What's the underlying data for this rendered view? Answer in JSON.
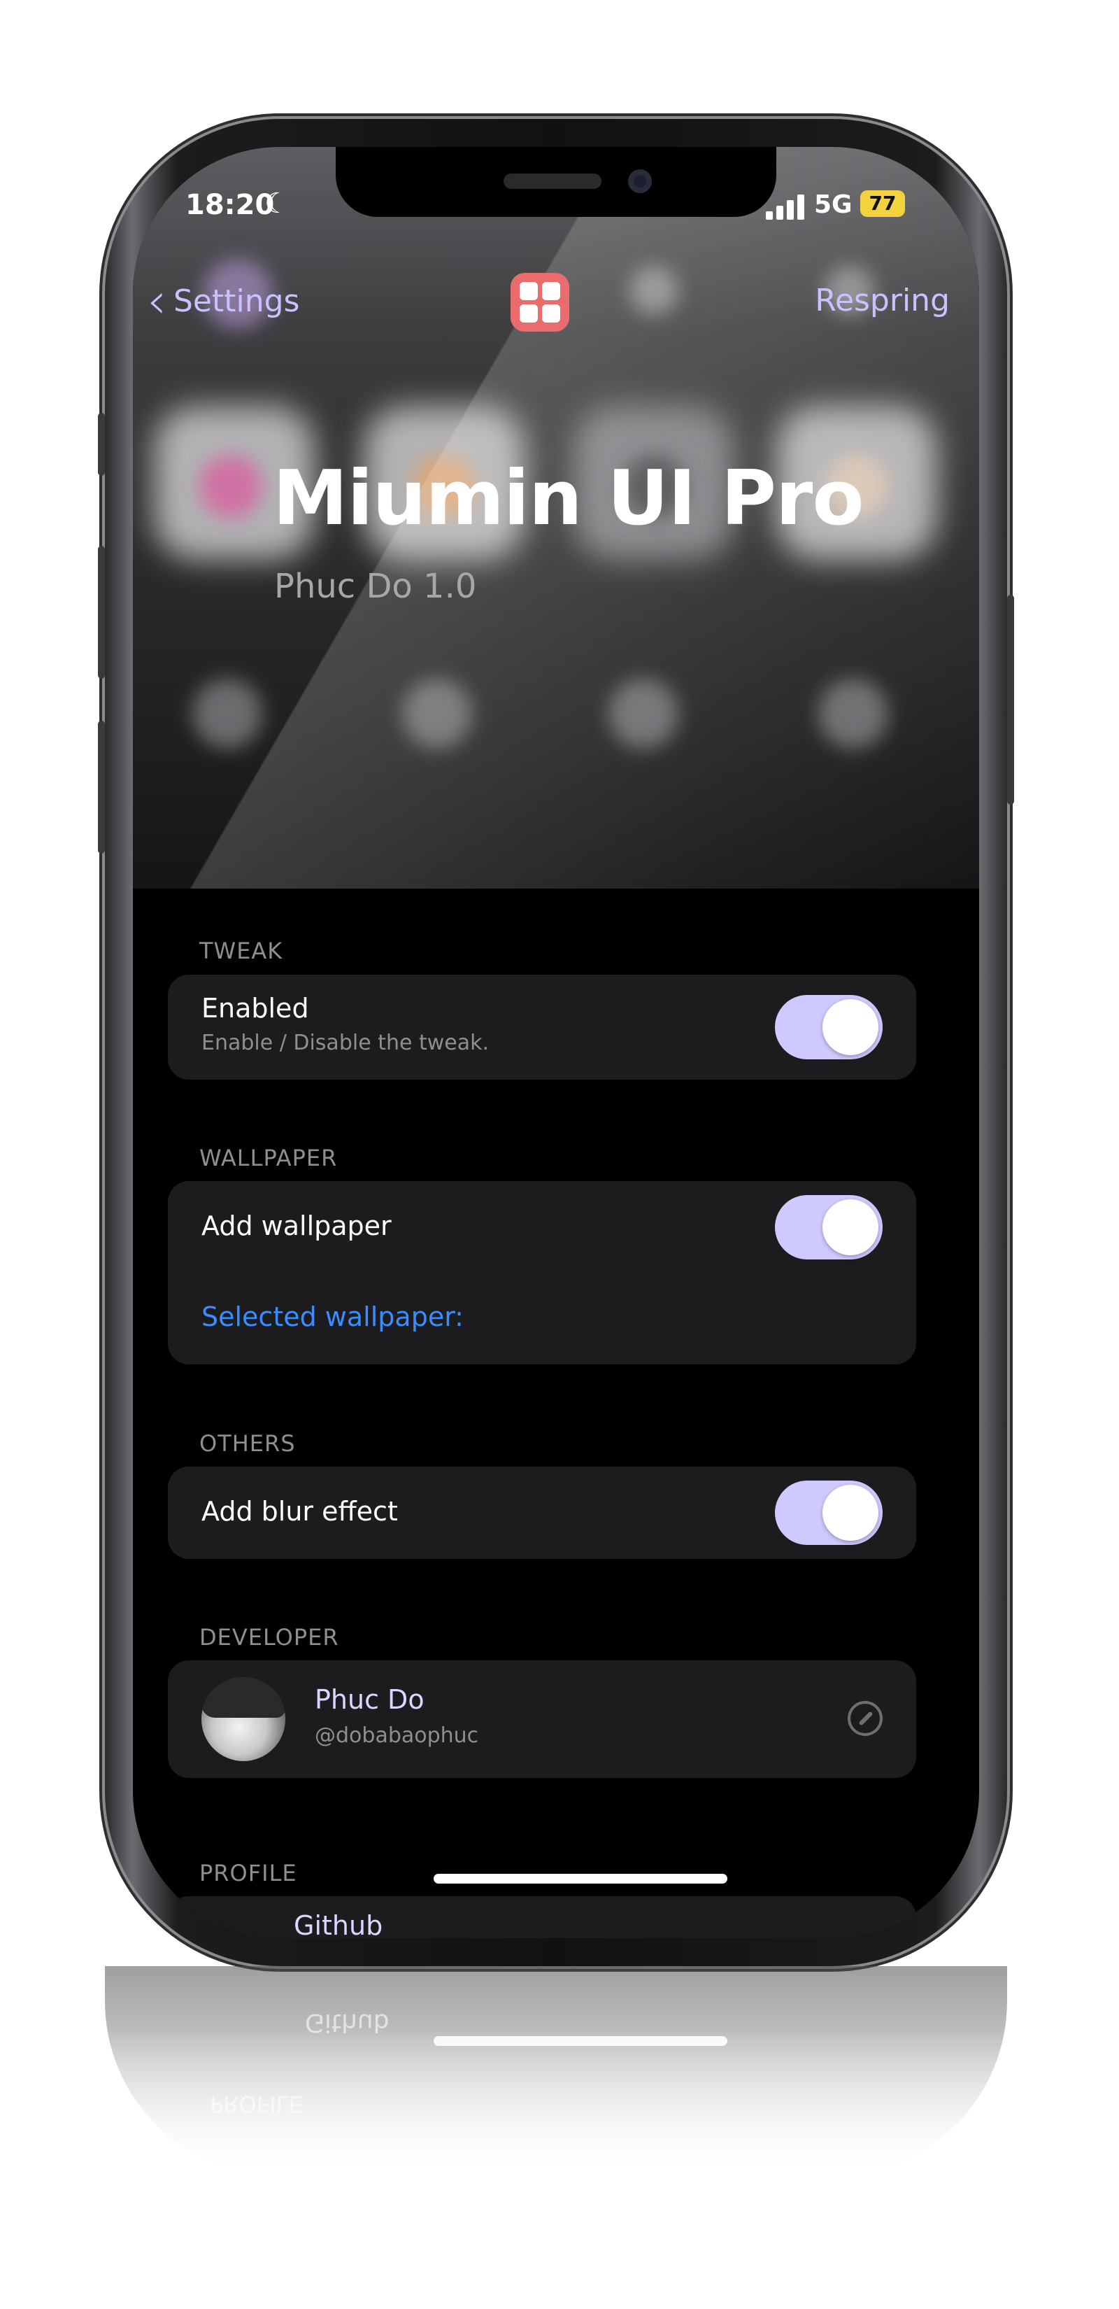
{
  "status_bar": {
    "time": "18:20",
    "network": "5G",
    "battery": "77"
  },
  "nav": {
    "back_label": "Settings",
    "action_label": "Respring"
  },
  "header": {
    "title": "Miumin UI Pro",
    "subtitle": "Phuc Do 1.0"
  },
  "sections": {
    "tweak": {
      "header": "TWEAK",
      "enabled_title": "Enabled",
      "enabled_subtitle": "Enable / Disable the tweak.",
      "enabled_on": true
    },
    "wallpaper": {
      "header": "WALLPAPER",
      "add_title": "Add wallpaper",
      "add_on": true,
      "selected_label": "Selected wallpaper:"
    },
    "others": {
      "header": "OTHERS",
      "blur_title": "Add blur effect",
      "blur_on": true
    },
    "developer": {
      "header": "DEVELOPER",
      "name": "Phuc Do",
      "handle": "@dobabaophuc"
    },
    "profile": {
      "header": "PROFILE",
      "github_label": "Github"
    }
  },
  "colors": {
    "accent": "#c8c3ff",
    "toggle_on": "#cec9ff",
    "link": "#3a8dff",
    "card": "#1c1c1e",
    "app_icon": "#ea6c6c",
    "battery": "#f2d33d"
  },
  "icons": {
    "back": "chevron-left-icon",
    "app": "grid-app-icon",
    "moon": "moon-icon",
    "signal": "cellular-signal-icon",
    "compass": "compass-icon"
  }
}
